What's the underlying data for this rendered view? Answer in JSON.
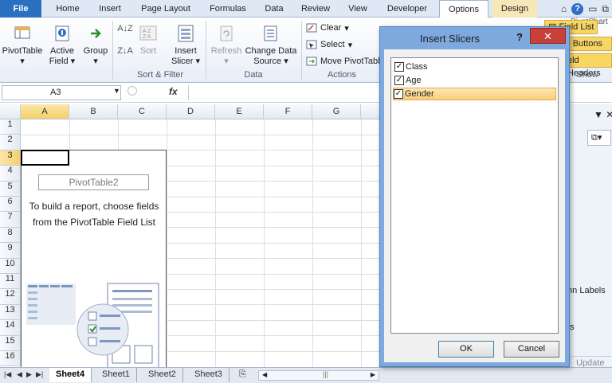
{
  "ribbon_tabs": [
    "File",
    "Home",
    "Insert",
    "Page Layout",
    "Formulas",
    "Data",
    "Review",
    "View",
    "Developer",
    "Options",
    "Design"
  ],
  "ribbon": {
    "pivottable_label": "PivotTable",
    "active_field_label": "Active Field",
    "group_label": "Group",
    "sort_label": "Sort",
    "insert_slicer_label": "Insert Slicer",
    "refresh_label": "Refresh",
    "change_data_source_label": "Change Data Source",
    "clear_label": "Clear",
    "select_label": "Select",
    "move_pivottable_label": "Move PivotTable",
    "group_sort_filter": "Sort & Filter",
    "group_data": "Data",
    "group_actions": "Actions",
    "pivotchart_label": "PivotChart",
    "field_list_label": "Field List",
    "buttons_label": "- Buttons",
    "field_headers_label": "eld Headers",
    "group_show": "Show"
  },
  "formula_bar": {
    "name_box": "A3",
    "fx": "fx",
    "value": ""
  },
  "grid": {
    "columns": [
      "A",
      "B",
      "C",
      "D",
      "E",
      "F",
      "G"
    ],
    "rows": [
      "1",
      "2",
      "3",
      "4",
      "5",
      "6",
      "7",
      "8",
      "9",
      "10",
      "11",
      "12",
      "13",
      "14",
      "15",
      "16"
    ],
    "selected_cell": "A3"
  },
  "pivot_placeholder": {
    "name": "PivotTable2",
    "message": "To build a report, choose fields from the PivotTable Field List"
  },
  "sheet_tabs": [
    "Sheet4",
    "Sheet1",
    "Sheet2",
    "Sheet3"
  ],
  "right_pane": {
    "column_labels": "mn Labels",
    "values": "es",
    "update": "Update"
  },
  "dialog": {
    "title": "Insert Slicers",
    "help": "?",
    "close": "✕",
    "items": [
      {
        "label": "Class",
        "checked": true
      },
      {
        "label": "Age",
        "checked": true
      },
      {
        "label": "Gender",
        "checked": true
      }
    ],
    "ok_label": "OK",
    "cancel_label": "Cancel"
  },
  "colors": {
    "file_tab": "#2a6fc0",
    "dialog_frame": "#7ea9df",
    "close_button": "#c7403a",
    "highlight": "#f8cf7a"
  }
}
